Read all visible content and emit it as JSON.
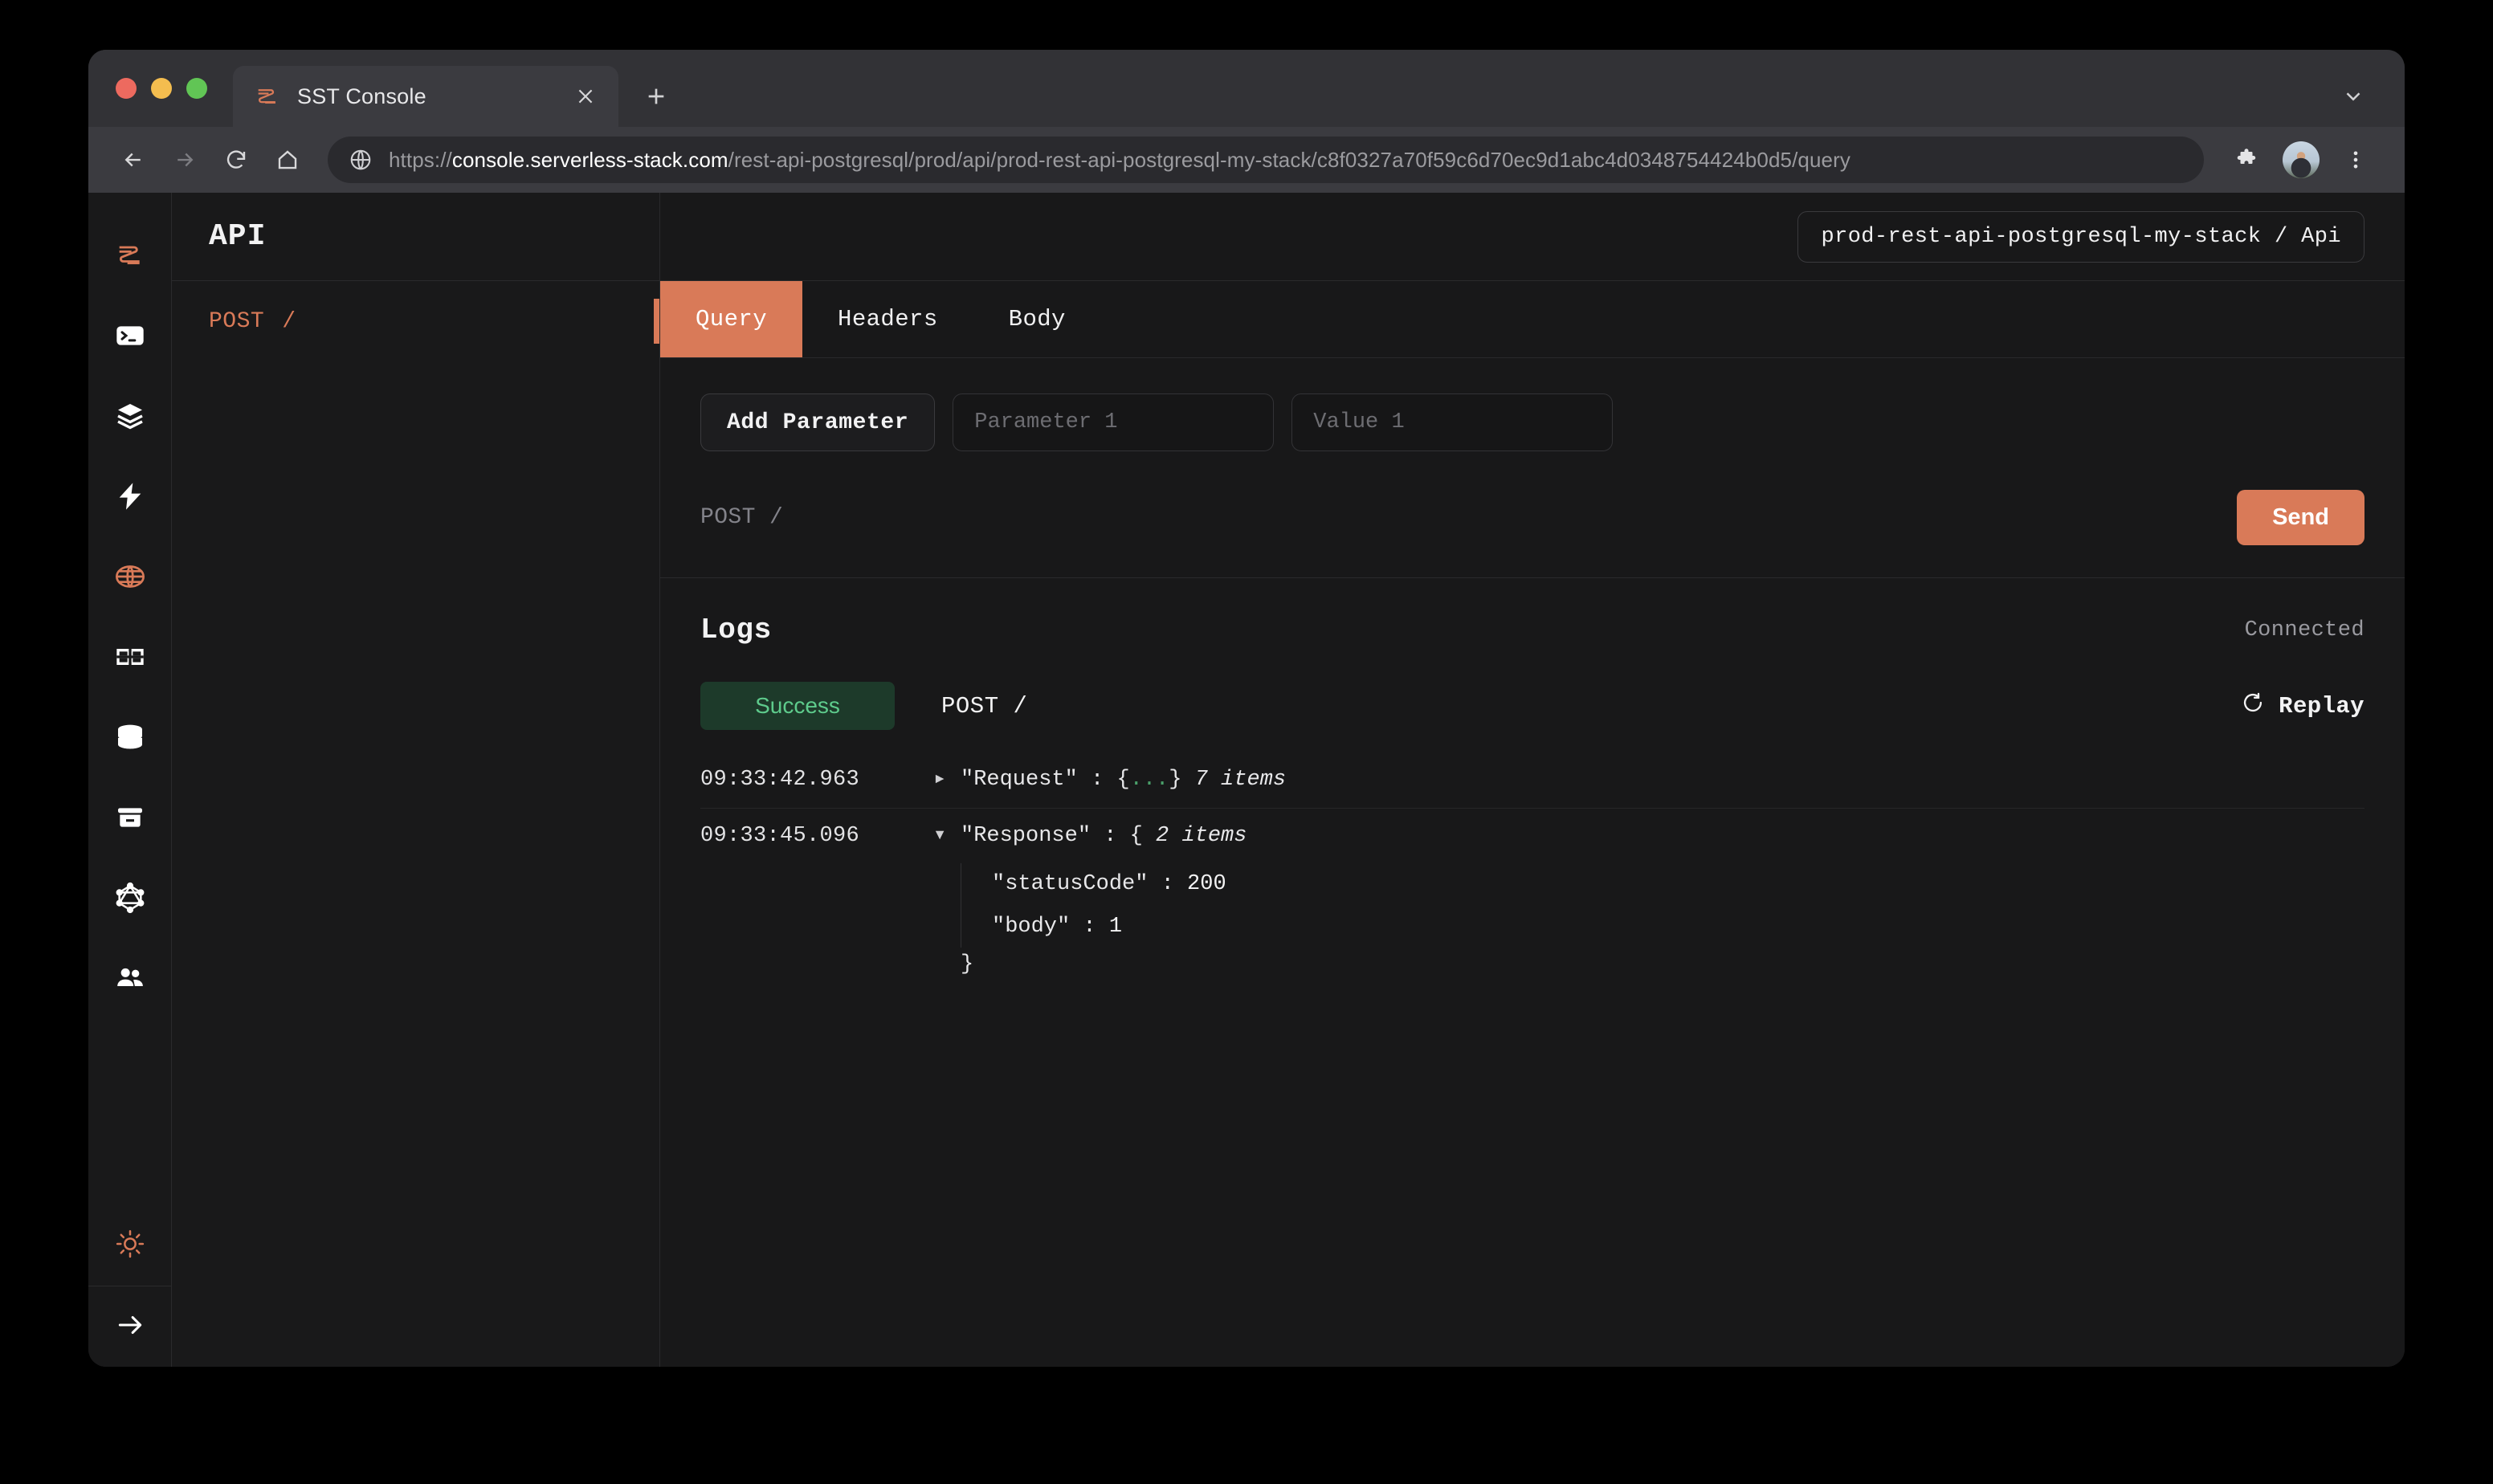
{
  "browser": {
    "tab": {
      "title": "SST Console",
      "favicon_icon": "sst-logo-icon",
      "close_icon": "close-icon"
    },
    "new_tab_icon": "plus-icon",
    "tabstrip_chevron_icon": "chevron-down-icon",
    "nav": {
      "back_icon": "arrow-left-icon",
      "forward_icon": "arrow-right-icon",
      "reload_icon": "reload-icon",
      "home_icon": "home-icon"
    },
    "omnibox": {
      "security_icon": "globe-icon",
      "scheme": "https://",
      "host": "console.serverless-stack.com",
      "path": "/rest-api-postgresql/prod/api/prod-rest-api-postgresql-my-stack/c8f0327a70f59c6d70ec9d1abc4d0348754424b0d5/query"
    },
    "actions": {
      "extensions_icon": "puzzle-icon",
      "profile_icon": "avatar",
      "menu_icon": "more-vertical-icon"
    }
  },
  "rail": {
    "items": [
      {
        "name": "sst-logo",
        "icon": "sst-logo-icon",
        "accent": true
      },
      {
        "name": "local",
        "icon": "terminal-icon",
        "accent": false
      },
      {
        "name": "stacks",
        "icon": "layers-icon",
        "accent": false
      },
      {
        "name": "functions",
        "icon": "lightning-icon",
        "accent": false
      },
      {
        "name": "api",
        "icon": "globe-icon",
        "accent": true
      },
      {
        "name": "dynamodb",
        "icon": "table-icon",
        "accent": false
      },
      {
        "name": "rds",
        "icon": "database-icon",
        "accent": false
      },
      {
        "name": "buckets",
        "icon": "bucket-icon",
        "accent": false
      },
      {
        "name": "graphql",
        "icon": "graphql-icon",
        "accent": false
      }
    ],
    "bottom": [
      {
        "name": "cognito",
        "icon": "users-icon",
        "accent": false
      }
    ],
    "footer": [
      {
        "name": "theme-toggle",
        "icon": "sun-icon",
        "accent": true
      },
      {
        "name": "expand-sidebar",
        "icon": "arrow-right-icon",
        "accent": false
      }
    ]
  },
  "routes": {
    "title": "API",
    "items": [
      {
        "method": "POST",
        "path": "/",
        "active": true
      }
    ]
  },
  "header": {
    "breadcrumb": "prod-rest-api-postgresql-my-stack / Api"
  },
  "tabs": [
    {
      "label": "Query",
      "active": true
    },
    {
      "label": "Headers",
      "active": false
    },
    {
      "label": "Body",
      "active": false
    }
  ],
  "query": {
    "add_parameter_label": "Add Parameter",
    "parameter_placeholder": "Parameter 1",
    "parameter_value": "",
    "value_placeholder": "Value 1",
    "value_value": "",
    "endpoint": "POST /",
    "send_label": "Send"
  },
  "logs": {
    "title": "Logs",
    "connection_status": "Connected",
    "entry": {
      "status_badge": "Success",
      "method_path": "POST /",
      "replay_label": "Replay",
      "replay_icon": "refresh-icon",
      "request": {
        "time": "09:33:42.963",
        "twisty": "▸",
        "key": "\"Request\"",
        "separator": " : ",
        "open": "{",
        "dots": "...",
        "close": "}",
        "count": "7 items"
      },
      "response": {
        "time": "09:33:45.096",
        "twisty": "▾",
        "key": "\"Response\"",
        "separator": " : ",
        "open": "{",
        "count": "2 items",
        "fields": [
          {
            "key": "\"statusCode\"",
            "separator": " : ",
            "value": "200"
          },
          {
            "key": "\"body\"",
            "separator": " : ",
            "value": "1"
          }
        ],
        "close": "}"
      }
    }
  },
  "colors": {
    "accent": "#d97a58",
    "success_text": "#5ecb8c",
    "success_bg": "#1d3a2a",
    "app_bg": "#19191a",
    "panel_border": "#2a2a2c"
  }
}
